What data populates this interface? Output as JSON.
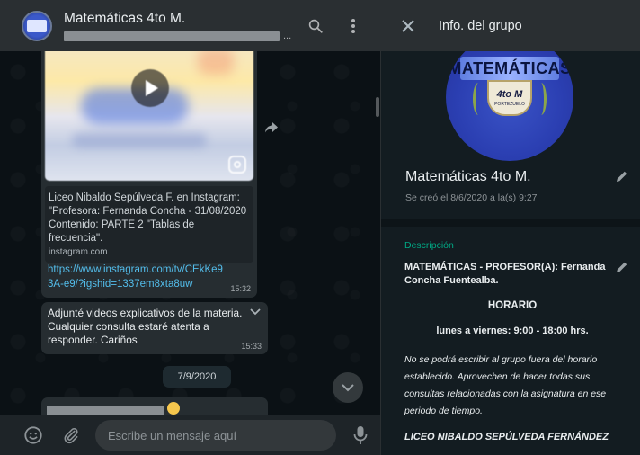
{
  "chat_header": {
    "title": "Matemáticas 4to M.",
    "subtitle_ellipsis": "..."
  },
  "media_message": {
    "preview_text": "Liceo Nibaldo Sepúlveda F. en Instagram: \"Profesora: Fernanda Concha - 31/08/2020 Contenido: PARTE 2 \"Tablas de frecuencia\".",
    "preview_domain": "instagram.com",
    "link": "https://www.instagram.com/tv/CEkKe93A-e9/?igshid=1337em8xta8uw",
    "time": "15:32"
  },
  "text_message": {
    "text": "Adjunté videos explicativos de la materia. Cualquier consulta estaré atenta a responder. Cariños",
    "time": "15:33"
  },
  "date_separator": "7/9/2020",
  "composer": {
    "placeholder": "Escribe un mensaje aquí"
  },
  "info_panel": {
    "title": "Info. del grupo",
    "group_photo": {
      "banner_text": "MATEMÁTICAS",
      "badge_text": "4to M",
      "badge_subtext": "PORTEZUELO"
    },
    "group_name": "Matemáticas 4to M.",
    "created": "Se creó el 8/6/2020 a la(s) 9:27",
    "description_label": "Descripción",
    "description": {
      "header": "MATEMÁTICAS - PROFESOR(A): Fernanda Concha Fuentealba.",
      "horario_title": "HORARIO",
      "hours": "lunes a viernes: 9:00 - 18:00 hrs.",
      "notice": "No se podrá escribir al grupo fuera del horario establecido. Aprovechen de hacer todas sus consultas relacionadas con la asignatura en ese periodo de tiempo.",
      "school": "LICEO NIBALDO SEPÚLVEDA FERNÁNDEZ"
    }
  },
  "colors": {
    "header_bg": "#2a2f32",
    "bubble_bg": "#262d31",
    "link": "#53bdeb",
    "accent": "#00a884",
    "panel_bg": "#131c21"
  }
}
